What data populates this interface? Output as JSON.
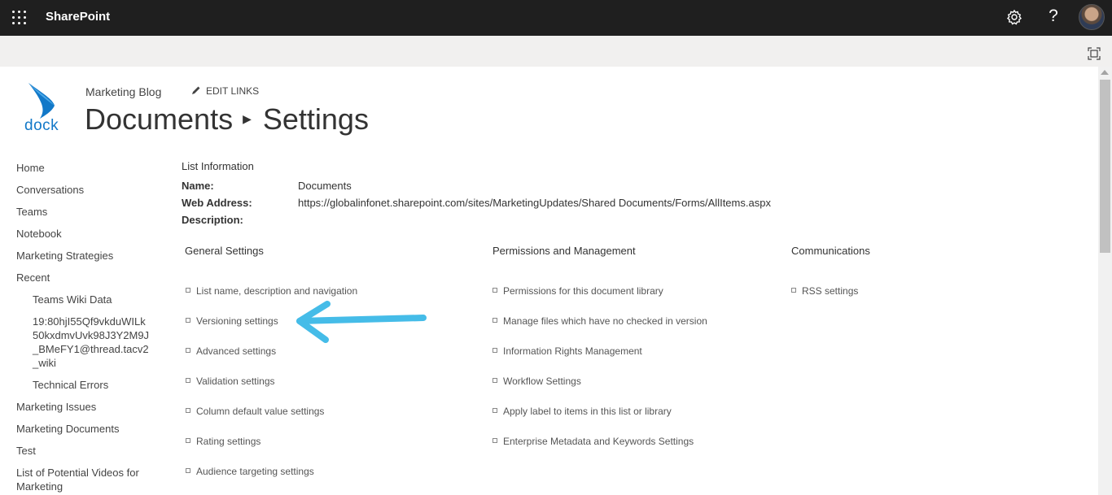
{
  "topbar": {
    "app_name": "SharePoint"
  },
  "site": {
    "name": "Marketing Blog",
    "edit_links": "EDIT LINKS",
    "logo_text": "dock"
  },
  "title": {
    "library": "Documents",
    "page": "Settings"
  },
  "nav": {
    "items": [
      "Home",
      "Conversations",
      "Teams",
      "Notebook",
      "Marketing Strategies",
      "Recent"
    ],
    "recent": [
      "Teams Wiki Data",
      "19:80hjI55Qf9vkduWILk",
      "50kxdmvUvk98J3Y2M9J",
      "_BMeFY1@thread.tacv2",
      "_wiki",
      "Technical Errors"
    ],
    "more": [
      "Marketing Issues",
      "Marketing Documents",
      "Test",
      "List of Potential Videos for",
      "Marketing"
    ]
  },
  "list_info": {
    "heading": "List Information",
    "name_label": "Name:",
    "name_value": "Documents",
    "address_label": "Web Address:",
    "address_value": "https://globalinfonet.sharepoint.com/sites/MarketingUpdates/Shared Documents/Forms/AllItems.aspx",
    "description_label": "Description:"
  },
  "sections": {
    "general": {
      "heading": "General Settings",
      "links": [
        "List name, description and navigation",
        "Versioning settings",
        "Advanced settings",
        "Validation settings",
        "Column default value settings",
        "Rating settings",
        "Audience targeting settings"
      ]
    },
    "permissions": {
      "heading": "Permissions and Management",
      "links": [
        "Permissions for this document library",
        "Manage files which have no checked in version",
        "Information Rights Management",
        "Workflow Settings",
        "Apply label to items in this list or library",
        "Enterprise Metadata and Keywords Settings"
      ]
    },
    "communications": {
      "heading": "Communications",
      "links": [
        "RSS settings"
      ]
    }
  },
  "colors": {
    "topbar": "#1f1f1f",
    "subbar": "#f1f0ef",
    "accent_arrow": "#45bce8",
    "logo": "#1278c8"
  },
  "icons": [
    "app-launcher-icon",
    "settings-gear-icon",
    "help-icon",
    "focus-mode-icon",
    "pencil-icon"
  ]
}
